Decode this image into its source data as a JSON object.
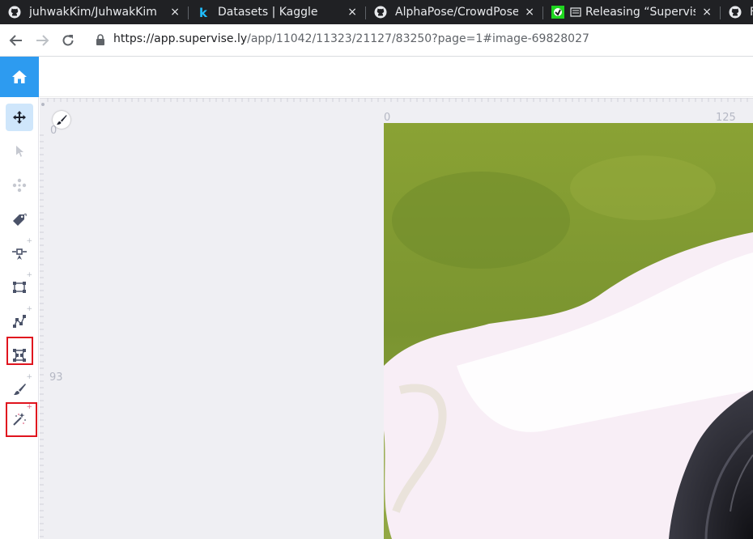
{
  "browser": {
    "tabs": [
      {
        "title": "juhwakKim/JuhwakKim",
        "icon": "github-icon"
      },
      {
        "title": "Datasets | Kaggle",
        "icon": "kaggle-icon"
      },
      {
        "title": "AlphaPose/CrowdPose",
        "icon": "github-icon"
      },
      {
        "title": "Releasing “Supervise",
        "icon": "supervisely-icon"
      },
      {
        "title": "F",
        "icon": "github-icon"
      }
    ],
    "close_glyph": "×",
    "url_host": "https://app.supervise.ly",
    "url_path": "/app/11042/11323/21127/83250?page=1#image-69828027"
  },
  "sidebar": {
    "tools": [
      {
        "name": "pan-tool",
        "icon": "move-arrows-icon",
        "active": true,
        "highlighted": false
      },
      {
        "name": "select-tool",
        "icon": "cursor-icon",
        "active": false,
        "highlighted": false
      },
      {
        "name": "drag-tool",
        "icon": "four-way-dots-icon",
        "active": false,
        "highlighted": false
      },
      {
        "name": "tag-tool",
        "icon": "tag-icon",
        "active": false,
        "highlighted": false
      },
      {
        "name": "point-tool",
        "icon": "point-icon",
        "active": false,
        "highlighted": false
      },
      {
        "name": "rectangle-tool",
        "icon": "rectangle-icon",
        "active": false,
        "highlighted": false
      },
      {
        "name": "polyline-tool",
        "icon": "polyline-icon",
        "active": false,
        "highlighted": false
      },
      {
        "name": "polygon-tool",
        "icon": "polygon-icon",
        "active": false,
        "highlighted": true
      },
      {
        "name": "brush-tool",
        "icon": "brush-icon",
        "active": false,
        "highlighted": false
      },
      {
        "name": "smart-tool",
        "icon": "magic-wand-icon",
        "active": false,
        "highlighted": true
      }
    ]
  },
  "canvas": {
    "ruler_left_labels": [
      "0",
      "93"
    ],
    "ruler_top_labels": [
      "0",
      "125"
    ]
  },
  "colors": {
    "accent": "#2d9bf0",
    "highlight": "#e0141e",
    "active_tool_bg": "#cfe6fb",
    "canvas_bg": "#efeff3"
  }
}
